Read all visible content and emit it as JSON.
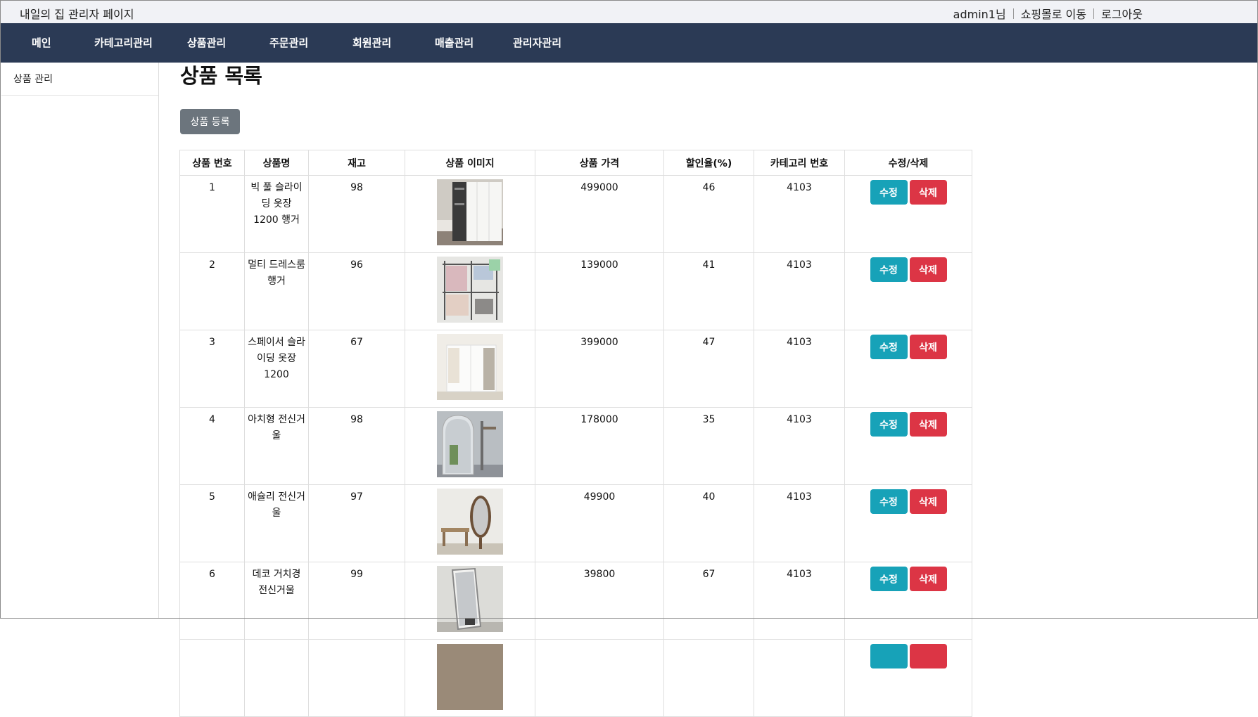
{
  "header": {
    "site_title": "내일의 집 관리자 페이지",
    "user": "admin1님",
    "shop_link": "쇼핑몰로 이동",
    "logout": "로그아웃"
  },
  "nav": [
    "메인",
    "카테고리관리",
    "상품관리",
    "주문관리",
    "회원관리",
    "매출관리",
    "관리자관리"
  ],
  "sidebar": {
    "items": [
      {
        "label": "상품 관리"
      }
    ]
  },
  "main": {
    "title": "상품 목록",
    "add_button": "상품 등록",
    "columns": [
      "상품 번호",
      "상품명",
      "재고",
      "상품 이미지",
      "상품 가격",
      "할인율(%)",
      "카테고리 번호",
      "수정/삭제"
    ],
    "edit_label": "수정",
    "delete_label": "삭제",
    "rows": [
      {
        "id": "1",
        "name": "빅 풀 슬라이딩 옷장 1200 행거",
        "stock": "98",
        "image": "wardrobe-photo",
        "price": "499000",
        "discount": "46",
        "category": "4103"
      },
      {
        "id": "2",
        "name": "멀티 드레스룸 행거",
        "stock": "96",
        "image": "clothes-rack-photo",
        "price": "139000",
        "discount": "41",
        "category": "4103"
      },
      {
        "id": "3",
        "name": "스페이서 슬라이딩 옷장 1200",
        "stock": "67",
        "image": "sliding-wardrobe-photo",
        "price": "399000",
        "discount": "47",
        "category": "4103"
      },
      {
        "id": "4",
        "name": "아치형 전신거울",
        "stock": "98",
        "image": "arch-mirror-photo",
        "price": "178000",
        "discount": "35",
        "category": "4103"
      },
      {
        "id": "5",
        "name": "애슐리 전신거울",
        "stock": "97",
        "image": "oval-mirror-photo",
        "price": "49900",
        "discount": "40",
        "category": "4103"
      },
      {
        "id": "6",
        "name": "데코 거치경 전신거울",
        "stock": "99",
        "image": "standing-mirror-photo",
        "price": "39800",
        "discount": "67",
        "category": "4103"
      }
    ]
  },
  "colors": {
    "nav_bg": "#2b3a55",
    "edit": "#17a2b8",
    "delete": "#dc3545",
    "secondary": "#6c757d"
  }
}
